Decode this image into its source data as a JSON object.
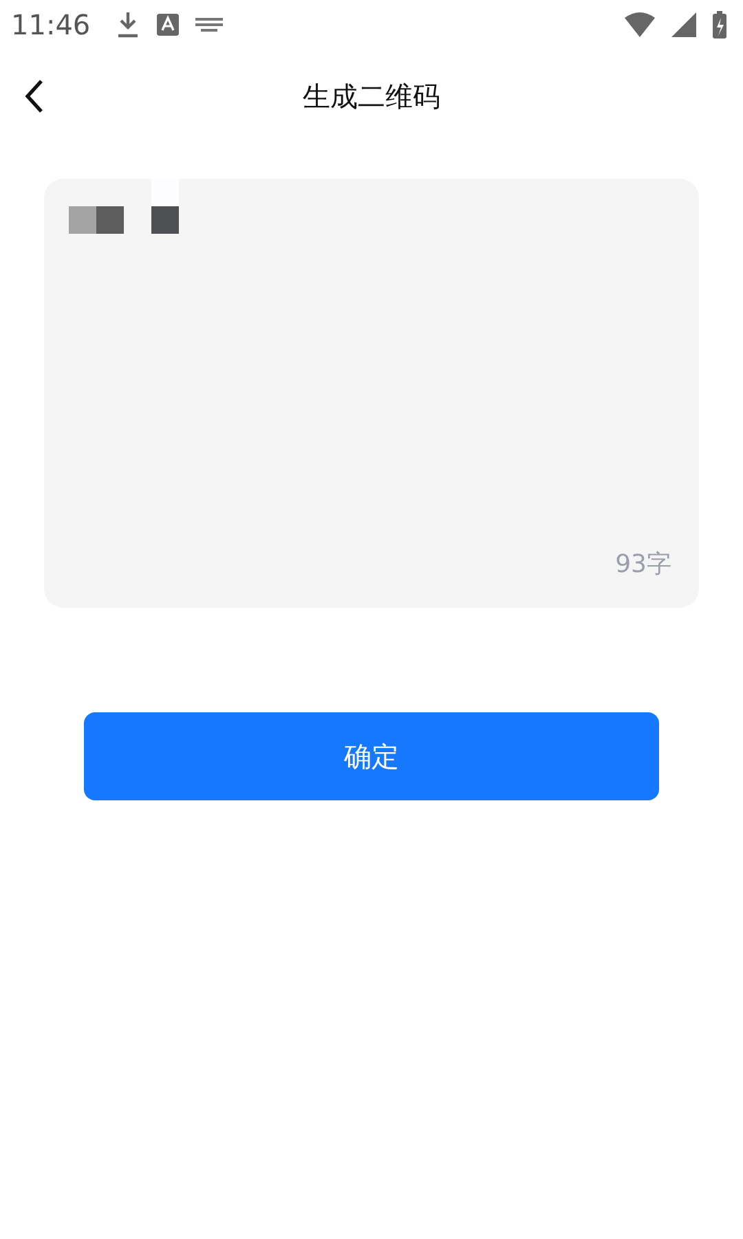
{
  "status_bar": {
    "time": "11:46"
  },
  "header": {
    "title": "生成二维码"
  },
  "text_area": {
    "counter": "93字"
  },
  "confirm_button": {
    "label": "确定"
  }
}
